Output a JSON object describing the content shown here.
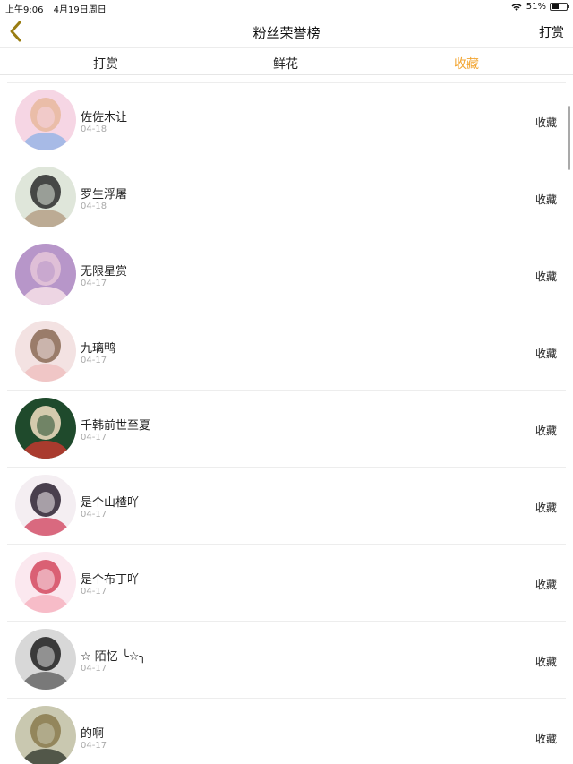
{
  "status_bar": {
    "time": "上午9:06",
    "date": "4月19日周日",
    "battery": "51%",
    "battery_level": 0.51
  },
  "nav": {
    "title": "粉丝荣誉榜",
    "action": "打赏"
  },
  "tabs": [
    {
      "label": "打赏",
      "active": false
    },
    {
      "label": "鲜花",
      "active": false
    },
    {
      "label": "收藏",
      "active": true
    }
  ],
  "colors": {
    "accent": "#f2a531",
    "back_icon": "#9a7d12"
  },
  "list": [
    {
      "name": "佐佐木让",
      "date": "04-18",
      "action": "收藏",
      "avatar_palette": [
        "#f6d6e4",
        "#e8b89e",
        "#9fb7e6"
      ]
    },
    {
      "name": "罗生浮屠",
      "date": "04-18",
      "action": "收藏",
      "avatar_palette": [
        "#dfe6da",
        "#2c2c2c",
        "#b8a48c"
      ]
    },
    {
      "name": "无限星赏",
      "date": "04-17",
      "action": "收藏",
      "avatar_palette": [
        "#b796c9",
        "#e6c7d9",
        "#f3dce6"
      ]
    },
    {
      "name": "九璃鸭",
      "date": "04-17",
      "action": "收藏",
      "avatar_palette": [
        "#f3e2e2",
        "#8a6a55",
        "#f0c3c3"
      ]
    },
    {
      "name": "千韩前世至夏",
      "date": "04-17",
      "action": "收藏",
      "avatar_palette": [
        "#1f4a2c",
        "#f4e0c4",
        "#b83a2f"
      ]
    },
    {
      "name": "是个山楂吖",
      "date": "04-17",
      "action": "收藏",
      "avatar_palette": [
        "#f4eef2",
        "#2a2030",
        "#d65a72"
      ]
    },
    {
      "name": "是个布丁吖",
      "date": "04-17",
      "action": "收藏",
      "avatar_palette": [
        "#fbe8ef",
        "#d4485e",
        "#f6b7c3"
      ]
    },
    {
      "name": "☆ 陌忆 ╰☆╮",
      "date": "04-17",
      "action": "收藏",
      "avatar_palette": [
        "#d8d8d8",
        "#1e1e1e",
        "#6f6f6f"
      ]
    },
    {
      "name": "的啊",
      "date": "04-17",
      "action": "收藏",
      "avatar_palette": [
        "#c9c8b0",
        "#8a7a4e",
        "#454a3e"
      ]
    }
  ]
}
